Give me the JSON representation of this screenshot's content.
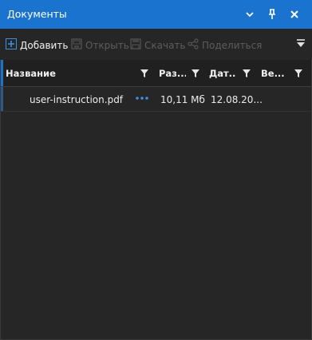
{
  "window": {
    "title": "Документы",
    "accent_color": "#1a73cf",
    "buttons": [
      "chevron-down-icon",
      "pin-icon",
      "close-icon"
    ]
  },
  "toolbar": {
    "add_label": "Добавить",
    "open_label": "Открыть",
    "download_label": "Скачать",
    "share_label": "Поделиться",
    "overflow_icon": "overflow-arrow-icon"
  },
  "table": {
    "columns": [
      {
        "label": "Название"
      },
      {
        "label": "Раз..."
      },
      {
        "label": "Дат..."
      },
      {
        "label": "Ве..."
      }
    ],
    "rows": [
      {
        "name": "user-instruction.pdf",
        "size": "10,11 Мб",
        "date": "12.08.20..."
      }
    ]
  }
}
